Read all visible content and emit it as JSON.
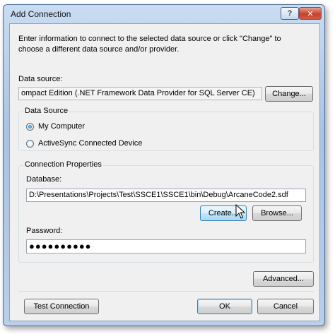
{
  "window": {
    "title": "Add Connection"
  },
  "titlebar": {
    "help_glyph": "?",
    "close_glyph": "✕"
  },
  "intro_text": "Enter information to connect to the selected data source or click \"Change\" to choose a different data source and/or provider.",
  "data_source": {
    "label": "Data source:",
    "value": "ompact Edition (.NET Framework Data Provider for SQL Server CE)",
    "change_label": "Change..."
  },
  "data_source_group": {
    "caption": "Data Source",
    "options": [
      {
        "label": "My Computer",
        "checked": true
      },
      {
        "label": "ActiveSync Connected Device",
        "checked": false
      }
    ]
  },
  "connection_group": {
    "caption": "Connection Properties",
    "database_label": "Database:",
    "database_value": "D:\\Presentations\\Projects\\Test\\SSCE1\\SSCE1\\bin\\Debug\\ArcaneCode2.sdf",
    "create_label": "Create...",
    "browse_label": "Browse...",
    "password_label": "Password:",
    "password_mask": "●●●●●●●●●●"
  },
  "buttons": {
    "advanced_label": "Advanced...",
    "test_label": "Test Connection",
    "ok_label": "OK",
    "cancel_label": "Cancel"
  },
  "icons": {
    "cursor": "mouse-pointer-icon"
  }
}
